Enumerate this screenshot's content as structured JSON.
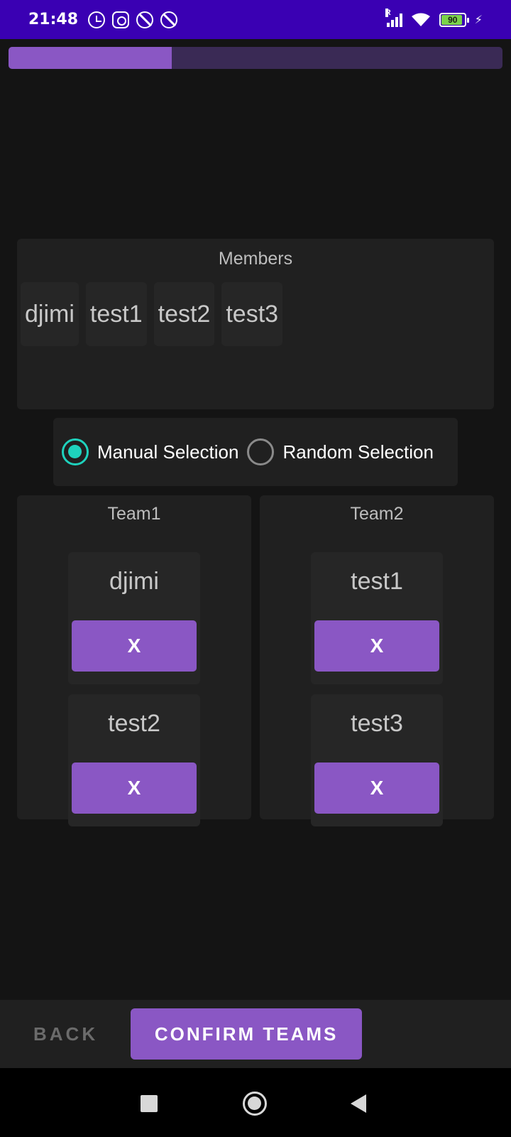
{
  "status_bar": {
    "time": "21:48",
    "battery": "90",
    "signal_label": "R"
  },
  "progress": {
    "value_percent": 33
  },
  "members": {
    "title": "Members",
    "items": [
      "djimi",
      "test1",
      "test2",
      "test3"
    ]
  },
  "selection_mode": {
    "options": [
      "Manual Selection",
      "Random Selection"
    ],
    "selected": "Manual Selection",
    "accent": "#1ed2bd"
  },
  "teams": [
    {
      "title": "Team1",
      "members": [
        {
          "name": "djimi",
          "remove_label": "X"
        },
        {
          "name": "test2",
          "remove_label": "X"
        }
      ]
    },
    {
      "title": "Team2",
      "members": [
        {
          "name": "test1",
          "remove_label": "X"
        },
        {
          "name": "test3",
          "remove_label": "X"
        }
      ]
    }
  ],
  "actions": {
    "back_label": "BACK",
    "confirm_label": "CONFIRM TEAMS"
  },
  "colors": {
    "primary": "#8a57c4",
    "status_bar": "#3a00b3",
    "background": "#141414"
  }
}
